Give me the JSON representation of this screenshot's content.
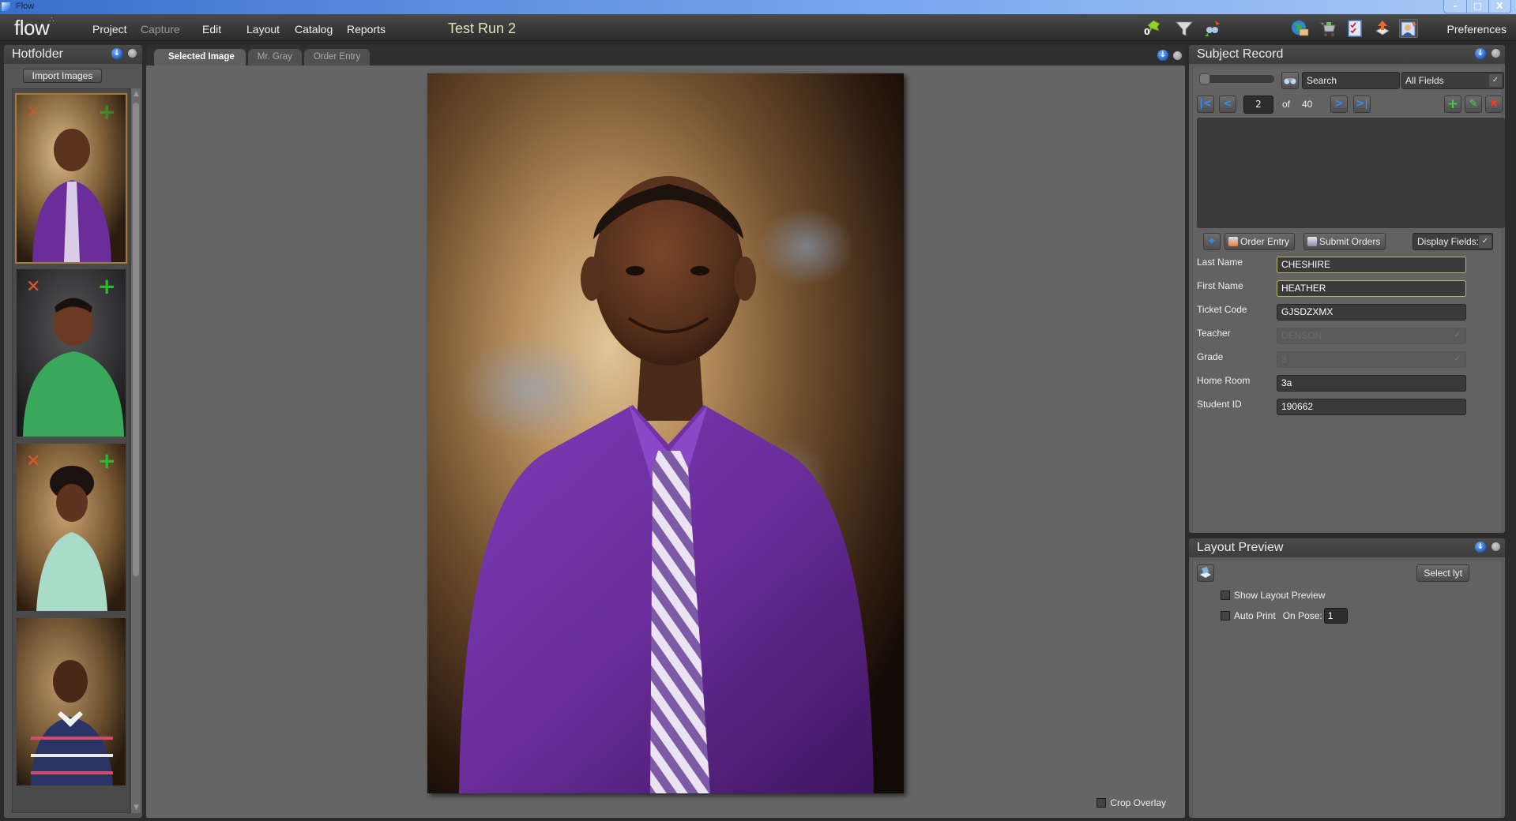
{
  "window": {
    "title": "Flow",
    "controls": {
      "minimize": "–",
      "maximize": "□",
      "close": "X"
    }
  },
  "menubar": {
    "logo": "flow",
    "items": [
      {
        "label": "Project",
        "enabled": true
      },
      {
        "label": "Capture",
        "enabled": false
      },
      {
        "label": "Edit",
        "enabled": true
      },
      {
        "label": "Layout",
        "enabled": true
      },
      {
        "label": "Catalog",
        "enabled": true
      },
      {
        "label": "Reports",
        "enabled": true
      }
    ],
    "project_title": "Test Run 2",
    "toolbar_icons": [
      "pushpin-icon",
      "filter-icon",
      "sync-icon",
      "globe-icon",
      "shopping-cart-icon",
      "checklist-icon",
      "upload-icon",
      "user-photo-icon"
    ],
    "pushpin_count": "0",
    "preferences_label": "Preferences"
  },
  "hotfolder": {
    "title": "Hotfolder",
    "import_label": "Import Images",
    "thumbnails": [
      {
        "subject": "boy in purple shirt and striped tie",
        "selected": true,
        "shirt": "#6a2d9a",
        "bg": "#6e5230"
      },
      {
        "subject": "boy in green shirt",
        "selected": false,
        "shirt": "#3aa85a",
        "bg": "#2c2c2e"
      },
      {
        "subject": "girl in mint dress",
        "selected": false,
        "shirt": "#a8dcc8",
        "bg": "#7a5a34"
      },
      {
        "subject": "boy in navy striped polo",
        "selected": false,
        "shirt": "#2a3566",
        "bg": "#6b5030"
      }
    ]
  },
  "center": {
    "tabs": [
      {
        "label": "Selected Image",
        "active": true
      },
      {
        "label": "Mr. Gray",
        "active": false
      },
      {
        "label": "Order Entry",
        "active": false
      }
    ],
    "main_image": "portrait of boy in purple shirt with striped tie",
    "crop_overlay_label": "Crop Overlay",
    "crop_overlay_checked": false
  },
  "subject_record": {
    "title": "Subject Record",
    "search_placeholder": "Search",
    "search_field_option": "All Fields",
    "current_record": "2",
    "of_label": "of",
    "total_records": "40",
    "order_entry_label": "Order Entry",
    "submit_orders_label": "Submit Orders",
    "display_fields_label": "Display Fields:",
    "fields": [
      {
        "label": "Last Name",
        "value": "CHESHIRE",
        "required": true,
        "disabled": false,
        "type": "text"
      },
      {
        "label": "First Name",
        "value": "HEATHER",
        "required": true,
        "disabled": false,
        "type": "text"
      },
      {
        "label": "Ticket Code",
        "value": "GJSDZXMX",
        "required": false,
        "disabled": false,
        "type": "text"
      },
      {
        "label": "Teacher",
        "value": "DENSON",
        "required": false,
        "disabled": true,
        "type": "select"
      },
      {
        "label": "Grade",
        "value": "3",
        "required": false,
        "disabled": true,
        "type": "select"
      },
      {
        "label": "Home Room",
        "value": "3a",
        "required": false,
        "disabled": false,
        "type": "text"
      },
      {
        "label": "Student ID",
        "value": "190662",
        "required": false,
        "disabled": false,
        "type": "text"
      }
    ]
  },
  "layout_preview": {
    "title": "Layout Preview",
    "select_layout_label": "Select lyt",
    "show_preview_label": "Show Layout Preview",
    "show_preview_checked": false,
    "auto_print_label": "Auto Print",
    "auto_print_checked": false,
    "on_pose_label": "On Pose:",
    "on_pose_value": "1"
  }
}
